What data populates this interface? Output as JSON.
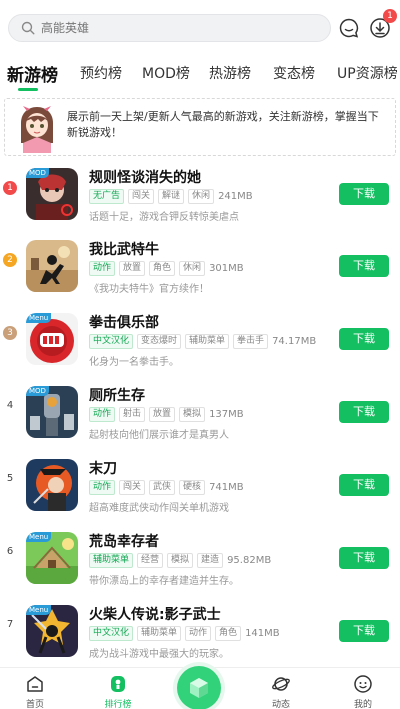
{
  "search": {
    "placeholder": "高能英雄"
  },
  "header": {
    "download_badge": "1"
  },
  "tabs": [
    {
      "label": "新游榜"
    },
    {
      "label": "预约榜"
    },
    {
      "label": "MOD榜"
    },
    {
      "label": "热游榜"
    },
    {
      "label": "变态榜"
    },
    {
      "label": "UP资源榜"
    }
  ],
  "banner": {
    "text": "展示前一天上架/更新人气最高的新游戏，关注新游榜，掌握当下新锐游戏！"
  },
  "games": [
    {
      "rank": "1",
      "name": "规则怪谈消失的她",
      "corner": "MOD",
      "tags": [
        {
          "t": "无广告",
          "g": true
        },
        {
          "t": "闯关",
          "g": false
        },
        {
          "t": "解谜",
          "g": false
        },
        {
          "t": "休闲",
          "g": false
        }
      ],
      "size": "241MB",
      "desc": "话题十足，游戏合钾反转惊美虐点",
      "button": "下载"
    },
    {
      "rank": "2",
      "name": "我比武特牛",
      "corner": "",
      "tags": [
        {
          "t": "动作",
          "g": true
        },
        {
          "t": "放置",
          "g": false
        },
        {
          "t": "角色",
          "g": false
        },
        {
          "t": "休闲",
          "g": false
        }
      ],
      "size": "301MB",
      "desc": "《我功夫特牛》官方续作！",
      "button": "下载"
    },
    {
      "rank": "3",
      "name": "拳击俱乐部",
      "corner": "Menu",
      "tags": [
        {
          "t": "中文汉化",
          "g": true
        },
        {
          "t": "变态爆时",
          "g": false
        },
        {
          "t": "辅助菜单",
          "g": false
        },
        {
          "t": "拳击手",
          "g": false
        }
      ],
      "size": "74.17MB",
      "desc": "化身为一名拳击手。",
      "button": "下载"
    },
    {
      "rank": "4",
      "name": "厕所生存",
      "corner": "MOD",
      "tags": [
        {
          "t": "动作",
          "g": true
        },
        {
          "t": "射击",
          "g": false
        },
        {
          "t": "放置",
          "g": false
        },
        {
          "t": "模拟",
          "g": false
        }
      ],
      "size": "137MB",
      "desc": "起射枝向他们展示谁才是真男人",
      "button": "下载"
    },
    {
      "rank": "5",
      "name": "末刀",
      "corner": "",
      "tags": [
        {
          "t": "动作",
          "g": true
        },
        {
          "t": "闯关",
          "g": false
        },
        {
          "t": "武侠",
          "g": false
        },
        {
          "t": "硬核",
          "g": false
        }
      ],
      "size": "741MB",
      "desc": "超高难度武侠动作闯关单机游戏",
      "button": "下载"
    },
    {
      "rank": "6",
      "name": "荒岛幸存者",
      "corner": "Menu",
      "tags": [
        {
          "t": "辅助菜单",
          "g": true
        },
        {
          "t": "经营",
          "g": false
        },
        {
          "t": "模拟",
          "g": false
        },
        {
          "t": "建造",
          "g": false
        }
      ],
      "size": "95.82MB",
      "desc": "带你漂岛上的幸存者建造并生存。",
      "button": "下载"
    },
    {
      "rank": "7",
      "name": "火柴人传说:影子武士",
      "corner": "Menu",
      "tags": [
        {
          "t": "中文汉化",
          "g": true
        },
        {
          "t": "辅助菜单",
          "g": false
        },
        {
          "t": "动作",
          "g": false
        },
        {
          "t": "角色",
          "g": false
        }
      ],
      "size": "141MB",
      "desc": "成为战斗游戏中最强大的玩家。",
      "button": "下载"
    }
  ],
  "bottom_nav": [
    {
      "label": "首页"
    },
    {
      "label": "排行榜"
    },
    {
      "label": ""
    },
    {
      "label": "动态"
    },
    {
      "label": "我的"
    }
  ],
  "colors": {
    "accent": "#13bf61",
    "rank1": "#f24a4a",
    "rank2": "#f5a623",
    "rank3": "#c9a07a"
  }
}
